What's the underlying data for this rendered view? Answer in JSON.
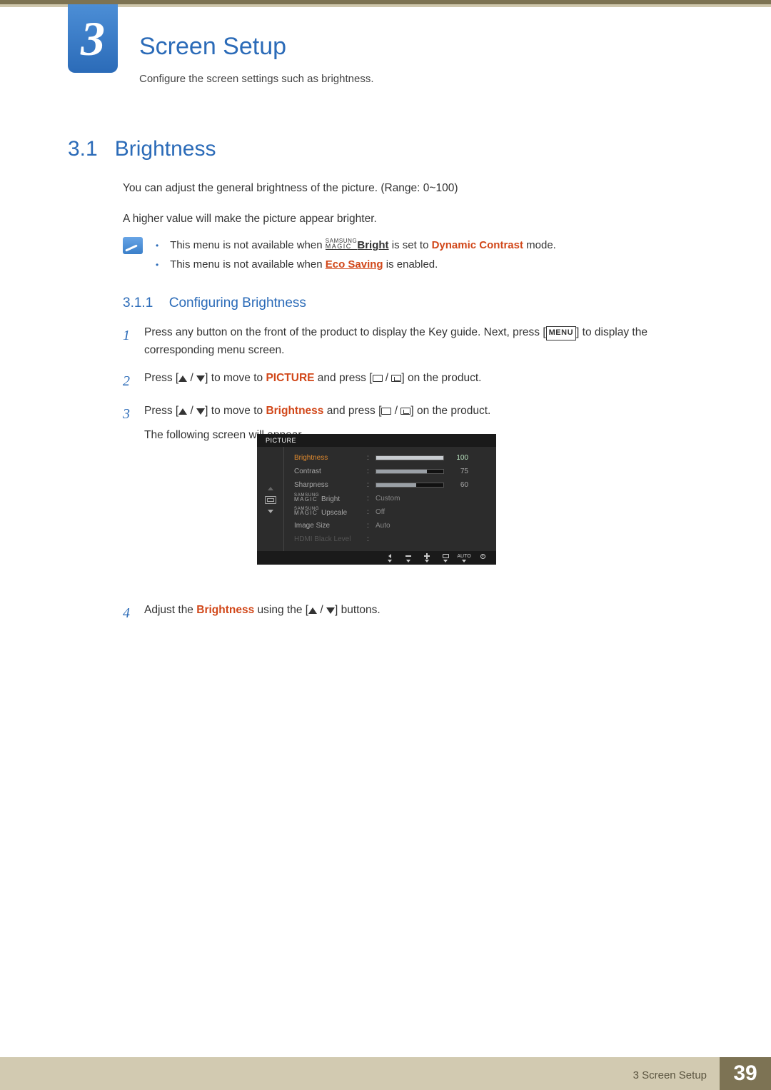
{
  "chapter": {
    "number": "3",
    "title": "Screen Setup",
    "intro": "Configure the screen settings such as brightness."
  },
  "section": {
    "number": "3.1",
    "title": "Brightness",
    "p1": "You can adjust the general brightness of the picture. (Range: 0~100)",
    "p2": "A higher value will make the picture appear brighter."
  },
  "notes": {
    "n1_a": "This menu is not available when ",
    "n1_magic_top": "SAMSUNG",
    "n1_magic_bot": "MAGIC",
    "n1_bright": "Bright",
    "n1_b": " is set to ",
    "n1_mode": "Dynamic Contrast",
    "n1_c": " mode.",
    "n2_a": "This menu is not available when ",
    "n2_link": "Eco Saving",
    "n2_b": " is enabled."
  },
  "subsection": {
    "number": "3.1.1",
    "title": "Configuring Brightness"
  },
  "steps": {
    "s1": {
      "num": "1",
      "a": "Press any button on the front of the product to display the Key guide. Next, press [",
      "menu": "MENU",
      "b": "] to display the corresponding menu screen."
    },
    "s2": {
      "num": "2",
      "a": "Press [",
      "b": "] to move to ",
      "kw": "PICTURE",
      "c": " and press [",
      "d": "] on the product."
    },
    "s3": {
      "num": "3",
      "a": "Press [",
      "b": "] to move to ",
      "kw": "Brightness",
      "c": " and press [",
      "d": "] on the product.",
      "follow": "The following screen will appear."
    },
    "s4": {
      "num": "4",
      "a": "Adjust the ",
      "kw": "Brightness",
      "b": " using the [",
      "c": "] buttons."
    }
  },
  "osd": {
    "title": "PICTURE",
    "rows": [
      {
        "label": "Brightness",
        "value": "100",
        "pct": 100,
        "selected": true,
        "type": "bar"
      },
      {
        "label": "Contrast",
        "value": "75",
        "pct": 75,
        "selected": false,
        "type": "bar"
      },
      {
        "label": "Sharpness",
        "value": "60",
        "pct": 60,
        "selected": false,
        "type": "bar"
      },
      {
        "label": "Bright",
        "value": "Custom",
        "selected": false,
        "type": "magic"
      },
      {
        "label": "Upscale",
        "value": "Off",
        "selected": false,
        "type": "magic"
      },
      {
        "label": "Image Size",
        "value": "Auto",
        "selected": false,
        "type": "text"
      },
      {
        "label": "HDMI Black Level",
        "value": "",
        "selected": false,
        "type": "dim"
      }
    ],
    "magic_top": "SAMSUNG",
    "magic_bot": "MAGIC",
    "footer_auto": "AUTO"
  },
  "footer": {
    "left": "3 Screen Setup",
    "page": "39"
  }
}
